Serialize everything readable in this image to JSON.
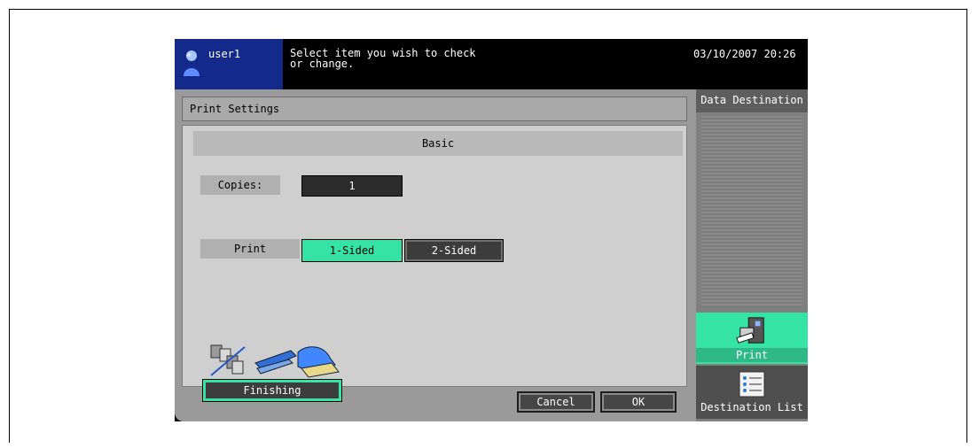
{
  "status": {
    "user": "user1",
    "message": "Select item you wish to check\nor change.",
    "datetime": "03/10/2007  20:26"
  },
  "panel": {
    "title": "Print Settings",
    "section": "Basic",
    "copies_label": "Copies:",
    "copies_value": "1",
    "print_label": "Print",
    "one_sided": "1-Sided",
    "two_sided": "2-Sided",
    "finishing": "Finishing"
  },
  "buttons": {
    "cancel": "Cancel",
    "ok": "OK"
  },
  "sidebar": {
    "header": "Data Destination",
    "print": "Print",
    "destination_list": "Destination List"
  },
  "colors": {
    "accent": "#35e3a7",
    "user_bg": "#142a8a"
  }
}
